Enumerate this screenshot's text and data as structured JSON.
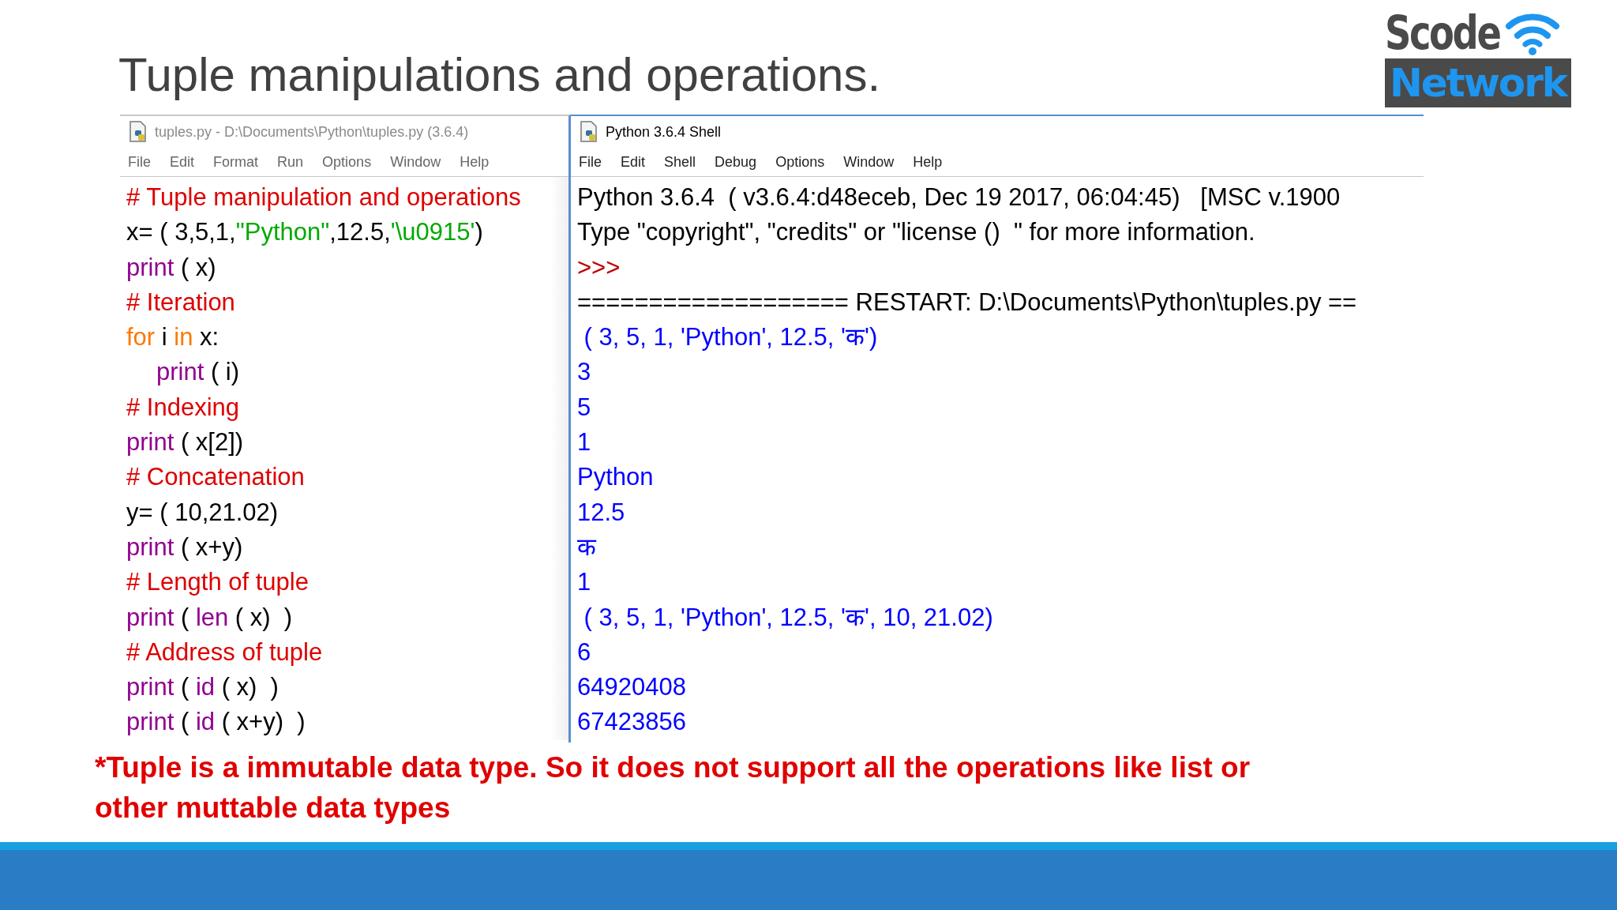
{
  "slide_title": "Tuple manipulations and operations.",
  "logo": {
    "top": "Scode",
    "bottom": "Network"
  },
  "editor": {
    "title": "tuples.py - D:\\Documents\\Python\\tuples.py (3.6.4)",
    "menu": [
      "File",
      "Edit",
      "Format",
      "Run",
      "Options",
      "Window",
      "Help"
    ],
    "lines": [
      {
        "tokens": [
          {
            "text": "# Tuple manipulation and operations",
            "kind": "comment"
          }
        ]
      },
      {
        "tokens": [
          {
            "text": "x= ( 3,5,1,",
            "kind": "plain"
          },
          {
            "text": "\"Python\"",
            "kind": "string"
          },
          {
            "text": ",12.5,",
            "kind": "plain"
          },
          {
            "text": "'\\u0915'",
            "kind": "string"
          },
          {
            "text": ")",
            "kind": "plain"
          }
        ]
      },
      {
        "tokens": [
          {
            "text": "print",
            "kind": "builtin"
          },
          {
            "text": " ( x)",
            "kind": "plain"
          }
        ]
      },
      {
        "tokens": [
          {
            "text": "# Iteration",
            "kind": "comment"
          }
        ]
      },
      {
        "tokens": [
          {
            "text": "for",
            "kind": "keyword"
          },
          {
            "text": " i ",
            "kind": "plain"
          },
          {
            "text": "in",
            "kind": "keyword"
          },
          {
            "text": " x:",
            "kind": "plain"
          }
        ],
        "children": [
          {
            "tokens": [
              {
                "text": "print",
                "kind": "builtin"
              },
              {
                "text": " ( i)",
                "kind": "plain"
              }
            ]
          }
        ]
      },
      {
        "tokens": [
          {
            "text": "# Indexing",
            "kind": "comment"
          }
        ]
      },
      {
        "tokens": [
          {
            "text": "print",
            "kind": "builtin"
          },
          {
            "text": " ( x[2])",
            "kind": "plain"
          }
        ]
      },
      {
        "tokens": [
          {
            "text": "# Concatenation",
            "kind": "comment"
          }
        ]
      },
      {
        "tokens": [
          {
            "text": "y= ( 10,21.02)",
            "kind": "plain"
          }
        ]
      },
      {
        "tokens": [
          {
            "text": "print",
            "kind": "builtin"
          },
          {
            "text": " ( x+y)",
            "kind": "plain"
          }
        ]
      },
      {
        "tokens": [
          {
            "text": "# Length of tuple",
            "kind": "comment"
          }
        ]
      },
      {
        "tokens": [
          {
            "text": "print",
            "kind": "builtin"
          },
          {
            "text": " ( ",
            "kind": "plain"
          },
          {
            "text": "len",
            "kind": "builtin"
          },
          {
            "text": " ( x)  )",
            "kind": "plain"
          }
        ]
      },
      {
        "tokens": [
          {
            "text": "# Address of tuple",
            "kind": "comment"
          }
        ]
      },
      {
        "tokens": [
          {
            "text": "print",
            "kind": "builtin"
          },
          {
            "text": " ( ",
            "kind": "plain"
          },
          {
            "text": "id",
            "kind": "builtin"
          },
          {
            "text": " ( x)  )",
            "kind": "plain"
          }
        ]
      },
      {
        "tokens": [
          {
            "text": "print",
            "kind": "builtin"
          },
          {
            "text": " ( ",
            "kind": "plain"
          },
          {
            "text": "id",
            "kind": "builtin"
          },
          {
            "text": " ( x+y)  )",
            "kind": "plain"
          }
        ]
      }
    ]
  },
  "shell": {
    "title": "Python 3.6.4 Shell",
    "menu": [
      "File",
      "Edit",
      "Shell",
      "Debug",
      "Options",
      "Window",
      "Help"
    ],
    "lines": [
      {
        "text": "Python 3.6.4  ( v3.6.4:d48eceb, Dec 19 2017, 06:04:45)   [MSC v.1900",
        "kind": "info"
      },
      {
        "text": "Type \"copyright\", \"credits\" or \"license ()  \" for more information.",
        "kind": "info"
      },
      {
        "text": ">>>",
        "kind": "prompt"
      },
      {
        "text": "=================== RESTART: D:\\Documents\\Python\\tuples.py ==",
        "kind": "info"
      },
      {
        "text": " ( 3, 5, 1, 'Python', 12.5, 'क')",
        "kind": "output"
      },
      {
        "text": "3",
        "kind": "output"
      },
      {
        "text": "5",
        "kind": "output"
      },
      {
        "text": "1",
        "kind": "output"
      },
      {
        "text": "Python",
        "kind": "output"
      },
      {
        "text": "12.5",
        "kind": "output"
      },
      {
        "text": "क",
        "kind": "output"
      },
      {
        "text": "1",
        "kind": "output"
      },
      {
        "text": " ( 3, 5, 1, 'Python', 12.5, 'क', 10, 21.02)",
        "kind": "output"
      },
      {
        "text": "6",
        "kind": "output"
      },
      {
        "text": "64920408",
        "kind": "output"
      },
      {
        "text": "67423856",
        "kind": "output"
      }
    ]
  },
  "note": "*Tuple is a immutable data type. So it does not support all the operations like list or other muttable data types"
}
